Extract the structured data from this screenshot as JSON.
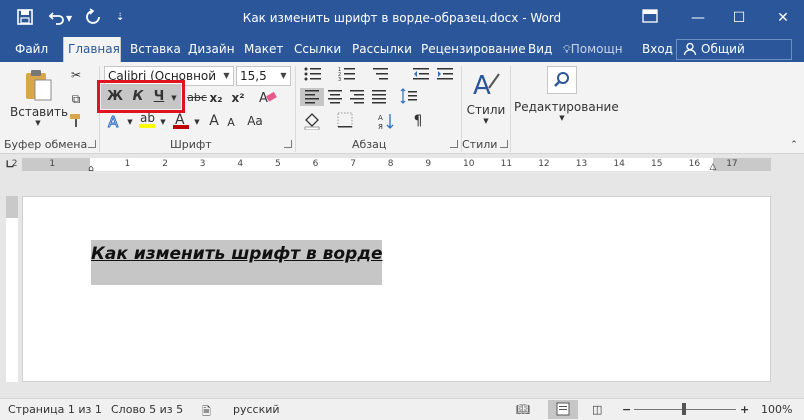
{
  "window": {
    "title": "Как изменить шрифт в ворде-образец.docx - Word",
    "title_bar_color": "#2b579a"
  },
  "quick_access": {
    "icons": [
      "save-icon",
      "undo-icon",
      "redo-icon",
      "customize-icon"
    ]
  },
  "tabs": [
    {
      "label": "Файл"
    },
    {
      "label": "Главная"
    },
    {
      "label": "Вставка"
    },
    {
      "label": "Дизайн"
    },
    {
      "label": "Макет"
    },
    {
      "label": "Ссылки"
    },
    {
      "label": "Рассылки"
    },
    {
      "label": "Рецензирование"
    },
    {
      "label": "Вид"
    },
    {
      "label": "Помощн"
    },
    {
      "label": "Вход"
    }
  ],
  "share_button": {
    "label": "Общий доступ"
  },
  "ribbon": {
    "clipboard": {
      "paste_label": "Вставить",
      "group_label": "Буфер обмена"
    },
    "font": {
      "font_name": "Calibri (Основной тек",
      "font_size": "15,5",
      "bold_glyph": "Ж",
      "italic_glyph": "К",
      "underline_glyph": "Ч",
      "strike_glyph": "abc",
      "subscript_glyph": "x₂",
      "superscript_glyph": "x²",
      "grow_glyph": "A",
      "shrink_glyph": "A",
      "case_glyph": "Aa",
      "group_label": "Шрифт",
      "font_color": "#c00000",
      "highlight_color": "#ffff00"
    },
    "paragraph": {
      "group_label": "Абзац",
      "pilcrow": "¶"
    },
    "styles": {
      "label": "Стили",
      "group_label": "Стили"
    },
    "editing": {
      "label": "Редактирование"
    },
    "highlight_frame_color": "#e0141e"
  },
  "ruler": {
    "numbers": [
      "2",
      "1",
      "1",
      "2",
      "3",
      "4",
      "5",
      "6",
      "7",
      "8",
      "9",
      "10",
      "11",
      "12",
      "13",
      "14",
      "15",
      "16",
      "17"
    ]
  },
  "document": {
    "text": "Как изменить шрифт в ворде"
  },
  "status_bar": {
    "page": "Страница 1 из 1",
    "words": "Слово 5 из 5",
    "language": "русский",
    "zoom": "100%"
  }
}
